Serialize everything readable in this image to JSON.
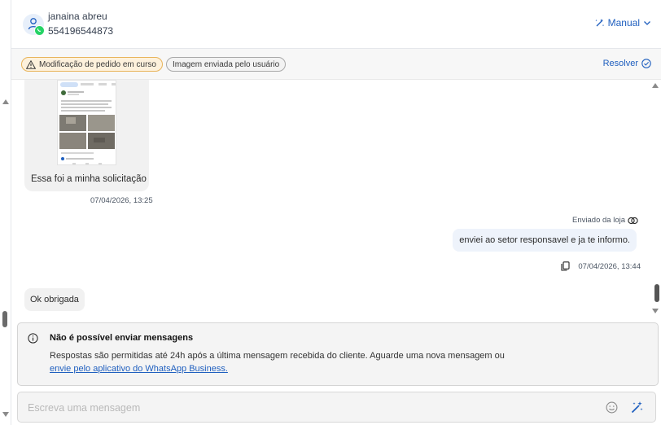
{
  "contact": {
    "name": "janaina abreu",
    "phone": "554196544873",
    "channel_icon": "whatsapp-icon"
  },
  "header": {
    "mode_label": "Manual",
    "mode_icon": "sparkles-icon"
  },
  "tags": [
    {
      "label": "Modificação de pedido em curso",
      "status": "warning",
      "icon": "warning-triangle-icon"
    },
    {
      "label": "Imagem enviada pelo usuário",
      "status": "neutral"
    }
  ],
  "resolve_label": "Resolver",
  "messages": [
    {
      "direction": "in",
      "type": "image",
      "caption": "Essa foi a minha solicitação",
      "time": "07/04/2026, 13:25"
    },
    {
      "direction": "out",
      "sender_label": "Enviado da loja",
      "text": "enviei ao setor responsavel e ja te informo.",
      "time": "07/04/2026, 13:44"
    },
    {
      "direction": "in",
      "type": "text",
      "text": "Ok obrigada"
    }
  ],
  "notice": {
    "title": "Não é possível enviar mensagens",
    "text": "Respostas são permitidas até 24h após a última mensagem recebida do cliente. Aguarde uma nova mensagem ou",
    "link": "envie pelo aplicativo do WhatsApp Business."
  },
  "composer": {
    "placeholder": "Escreva uma mensagem"
  },
  "colors": {
    "accent": "#1f5fbf",
    "whatsapp": "#25d366",
    "warning_bg": "#fdf1dc",
    "warning_border": "#e8b45a",
    "outgoing_bubble": "#eef3fb",
    "incoming_bubble": "#f1f1f1"
  }
}
